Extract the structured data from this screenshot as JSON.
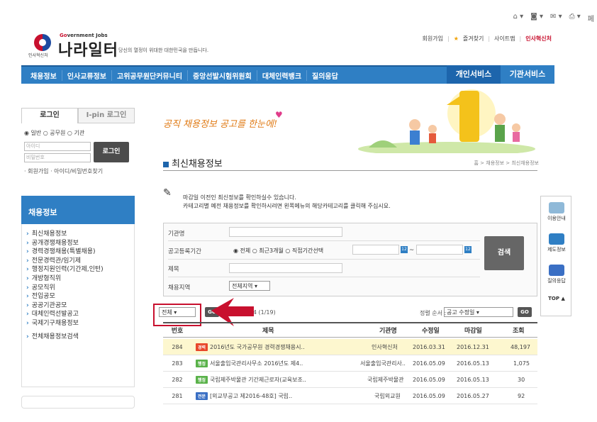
{
  "browser": {
    "toolbar_icons": [
      "home-icon",
      "feeds-icon",
      "mail-icon",
      "print-icon",
      "page-icon"
    ]
  },
  "header": {
    "logo_small": "인사혁신처",
    "logo_gov_prefix": "Go",
    "logo_gov_rest": "vernment Jobs",
    "logo_main": "나라일터",
    "slogan": "당신의 열정이 위대한 대한민국을 만듭니다.",
    "links": {
      "signup": "회원가입",
      "favorites": "즐겨찾기",
      "sitemap": "사이트맵",
      "mpm": "인사혁신처"
    }
  },
  "nav": {
    "items": [
      "채용정보",
      "인사교류정보",
      "고위공무원단커뮤니티",
      "중앙선발시험위원회",
      "대체인력뱅크",
      "질의응답"
    ],
    "personal": "개인서비스",
    "agency": "기관서비스"
  },
  "login": {
    "tab_login": "로그인",
    "tab_ipin": "I-pin 로그인",
    "radio": "◉ 일반 ○ 공무원 ○ 기관",
    "id_placeholder": "아이디",
    "pw_placeholder": "비밀번호",
    "button": "로그인",
    "links": "· 회원가입 · 아이디/비밀번호찾기"
  },
  "sidebar": {
    "title": "채용정보",
    "items": [
      "최신채용정보",
      "공개경쟁채용정보",
      "경력경쟁채용(특별채용)",
      "전문경력관/임기제",
      "행정지원인력(기간제,인턴)",
      "개방형직위",
      "공모직위",
      "전입공모",
      "공공기관공모",
      "대체인력선발공고",
      "국제기구채용정보",
      "전체채용정보검색"
    ]
  },
  "banner": {
    "text": "공직 채용정보 공고를 한눈에!"
  },
  "section": {
    "title": "최신채용정보",
    "breadcrumb": "홈 > 채용정보 > 최신채용정보",
    "notice_line1": "마감일 이전인 최신정보를 확인하실수 있습니다.",
    "notice_line2": "카테고리별 예전 채용정보를 확인하시려면 왼쪽메뉴의 해당카테고리를 클릭해 주십시요."
  },
  "search": {
    "label_agency": "기관명",
    "label_period": "공고등록기간",
    "period_options": "◉ 전체 ○ 최근3개월 ○ 직접기간선택",
    "tilde": "~",
    "label_title": "제목",
    "label_region": "채용지역",
    "region_value": "전체지역",
    "button": "검색"
  },
  "list": {
    "category_value": "전체",
    "go": "GO",
    "total": "T",
    "total_count": "4 (1/19)",
    "sort_label": "정렬 순서 :",
    "sort_value": "공고 수정일",
    "headers": [
      "번호",
      "제목",
      "기관명",
      "수정일",
      "마감일",
      "조회"
    ],
    "rows": [
      {
        "no": "284",
        "tag": "경력",
        "tag_color": "#e8472a",
        "title": "2016년도 국가공무원 경력경쟁채용시..",
        "agency": "인사혁신처",
        "modified": "2016.03.31",
        "deadline": "2016.12.31",
        "views": "48,197",
        "highlight": true
      },
      {
        "no": "283",
        "tag": "행정",
        "tag_color": "#5ab24a",
        "title": "서울출입국관리사무소 2016년도 제4..",
        "agency": "서울출입국관리사..",
        "modified": "2016.05.09",
        "deadline": "2016.05.13",
        "views": "1,075",
        "highlight": false
      },
      {
        "no": "282",
        "tag": "행정",
        "tag_color": "#5ab24a",
        "title": "국립제주박물관 기간제근로자(교육보조..",
        "agency": "국립제주박물관",
        "modified": "2016.05.09",
        "deadline": "2016.05.13",
        "views": "30",
        "highlight": false
      },
      {
        "no": "281",
        "tag": "전문",
        "tag_color": "#3a6fc4",
        "title": "[외교부공고 제2016-48호] 국립..",
        "agency": "국립외교원",
        "modified": "2016.05.09",
        "deadline": "2016.05.27",
        "views": "92",
        "highlight": false
      }
    ]
  },
  "quick_menu": {
    "items": [
      "이용안내",
      "제도정보",
      "질의응답"
    ],
    "top": "TOP ▲"
  },
  "colors": {
    "primary": "#2f7fc4",
    "accent": "#c8102e",
    "highlight_row": "#fdf7cf"
  }
}
